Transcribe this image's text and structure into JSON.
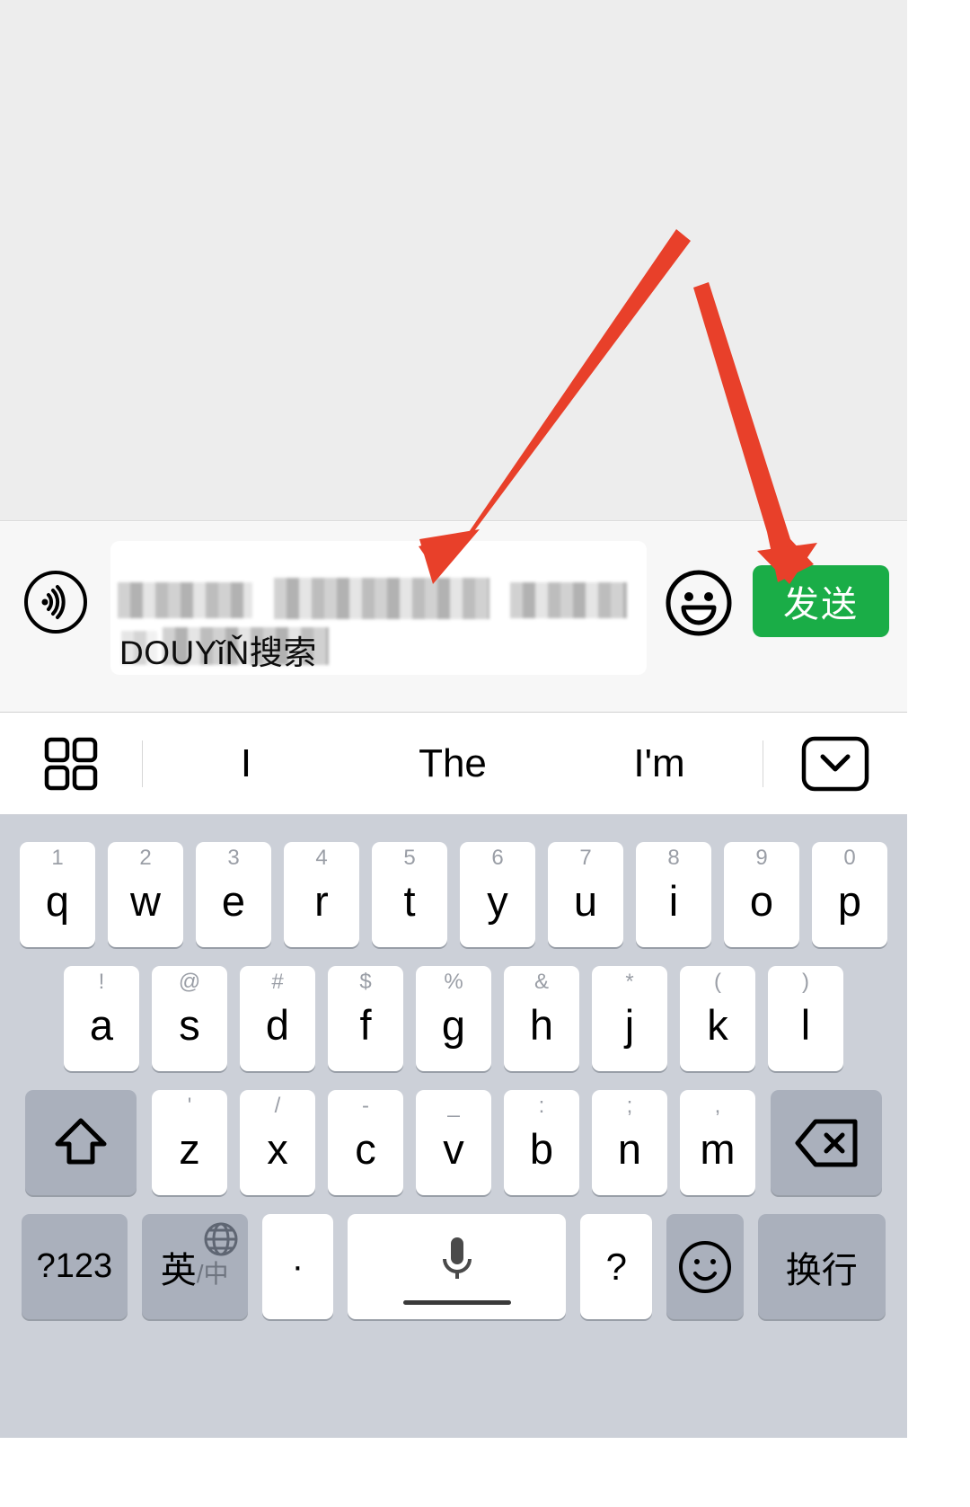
{
  "app": {
    "platform": "ios-chat",
    "accent_green": "#1aad47",
    "keyboard_bg": "#ccd0d8",
    "arrow_color": "#e8402a",
    "chat_bg": "#ededed"
  },
  "chat": {
    "messages": []
  },
  "input_bar": {
    "voice_icon": "voice-wave-icon",
    "text_field": {
      "line1": "",
      "line2_visible": "DOUYǐŇ搜索",
      "redacted": true
    },
    "emoji_icon": "smiley-face-icon",
    "send_label": "发送"
  },
  "suggest_bar": {
    "left_icon": "grid-apps-icon",
    "words": [
      "I",
      "The",
      "I'm"
    ],
    "right_icon": "chevron-down-box-icon"
  },
  "keyboard": {
    "row1": [
      {
        "letter": "q",
        "num": "1"
      },
      {
        "letter": "w",
        "num": "2"
      },
      {
        "letter": "e",
        "num": "3"
      },
      {
        "letter": "r",
        "num": "4"
      },
      {
        "letter": "t",
        "num": "5"
      },
      {
        "letter": "y",
        "num": "6"
      },
      {
        "letter": "u",
        "num": "7"
      },
      {
        "letter": "i",
        "num": "8"
      },
      {
        "letter": "o",
        "num": "9"
      },
      {
        "letter": "p",
        "num": "0"
      }
    ],
    "row2": [
      {
        "letter": "a",
        "num": "!"
      },
      {
        "letter": "s",
        "num": "@"
      },
      {
        "letter": "d",
        "num": "#"
      },
      {
        "letter": "f",
        "num": "$"
      },
      {
        "letter": "g",
        "num": "%"
      },
      {
        "letter": "h",
        "num": "&"
      },
      {
        "letter": "j",
        "num": "*"
      },
      {
        "letter": "k",
        "num": "("
      },
      {
        "letter": "l",
        "num": ")"
      }
    ],
    "row3": {
      "shift_icon": "shift-arrow-up-icon",
      "keys": [
        {
          "letter": "z",
          "num": "'"
        },
        {
          "letter": "x",
          "num": "/"
        },
        {
          "letter": "c",
          "num": "-"
        },
        {
          "letter": "v",
          "num": "_"
        },
        {
          "letter": "b",
          "num": ":"
        },
        {
          "letter": "n",
          "num": ";"
        },
        {
          "letter": "m",
          "num": ","
        }
      ],
      "backspace_icon": "backspace-delete-icon"
    },
    "row4": {
      "numeric_label": "?123",
      "lang_label_primary": "英",
      "lang_label_sep": "/",
      "lang_label_secondary": "中",
      "globe_icon": "globe-icon",
      "period_label": "·",
      "space_icon": "microphone-icon",
      "question_label": "?",
      "smiley_icon": "smiley-outline-icon",
      "enter_label": "换行"
    }
  },
  "annotations": {
    "arrow1": {
      "name": "arrow-to-text-field",
      "color": "#e8402a"
    },
    "arrow2": {
      "name": "arrow-to-send-button",
      "color": "#e8402a"
    }
  }
}
